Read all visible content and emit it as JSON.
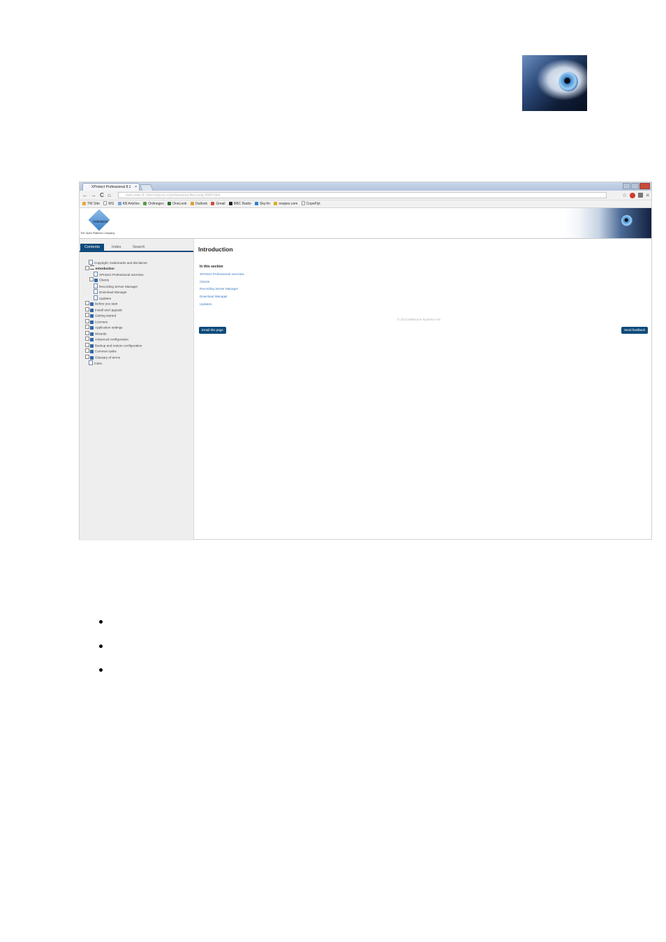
{
  "browser": {
    "tab_title": "XProtect Professional 8.1",
    "tab_close": "×",
    "nav": {
      "back": "←",
      "forward": "→",
      "reload": "C",
      "home": "⌂"
    },
    "address": "dark-mike-8, html-help-lxc-c/professional-files-help-9999.html",
    "star": "☆",
    "menu": "≡",
    "bookmarks": [
      "TW Site",
      "WS",
      "KB Articles",
      "Onlineges",
      "OneLook",
      "Outlook",
      "Gmail",
      "BBC Radio",
      "Sky.fm",
      "snopes.com",
      "CopeFlyt"
    ]
  },
  "header": {
    "logo_text": "milestone",
    "tagline": "The Open Platform Company"
  },
  "sidebar": {
    "tabs": [
      "Contents",
      "Index",
      "Search"
    ],
    "toc": [
      {
        "label": "Copyright, trademarks and disclaimer",
        "level": 1,
        "icon": "page"
      },
      {
        "label": "Introduction",
        "level": 0,
        "icon": "open-book",
        "expander": true,
        "bold": true
      },
      {
        "label": "XProtect Professional overview",
        "level": 2,
        "icon": "page"
      },
      {
        "label": "Clients",
        "level": 1,
        "icon": "book",
        "expander": true
      },
      {
        "label": "Recording Server Manager",
        "level": 2,
        "icon": "page"
      },
      {
        "label": "Download Manager",
        "level": 2,
        "icon": "page"
      },
      {
        "label": "Updates",
        "level": 2,
        "icon": "page"
      },
      {
        "label": "Before you start",
        "level": 0,
        "icon": "book",
        "expander": true
      },
      {
        "label": "Install and upgrade",
        "level": 0,
        "icon": "book",
        "expander": true
      },
      {
        "label": "Getting started",
        "level": 0,
        "icon": "book",
        "expander": true
      },
      {
        "label": "Licenses",
        "level": 0,
        "icon": "book",
        "expander": true
      },
      {
        "label": "Application settings",
        "level": 0,
        "icon": "book",
        "expander": true
      },
      {
        "label": "Wizards",
        "level": 0,
        "icon": "book",
        "expander": true
      },
      {
        "label": "Advanced configuration",
        "level": 0,
        "icon": "book",
        "expander": true
      },
      {
        "label": "Backup and restore configuration",
        "level": 0,
        "icon": "book",
        "expander": true
      },
      {
        "label": "Common tasks",
        "level": 0,
        "icon": "book",
        "expander": true
      },
      {
        "label": "Glossary of terms",
        "level": 0,
        "icon": "book",
        "expander": true
      },
      {
        "label": "Index",
        "level": 1,
        "icon": "page"
      }
    ]
  },
  "content": {
    "title": "Introduction",
    "section_heading": "In this section",
    "links": [
      "XProtect Professional overview",
      "Clients",
      "Recording Server Manager",
      "Download Manager",
      "Updates"
    ],
    "copyright": "© 2013 Milestone Systems A/S",
    "email_button": "Email this page",
    "feedback_button": "Send feedback"
  }
}
